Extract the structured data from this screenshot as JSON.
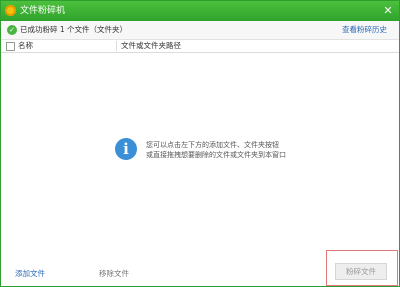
{
  "window": {
    "title": "文件粉碎机",
    "close_glyph": "✕"
  },
  "status": {
    "message": "已成功粉碎 1 个文件（文件夹）",
    "history_link": "查看粉碎历史"
  },
  "table": {
    "columns": [
      "名称",
      "文件或文件夹路径"
    ]
  },
  "hint": {
    "line1": "您可以点击左下方的添加文件、文件夹按钮",
    "line2": "或直接拖拽想要删除的文件或文件夹到本窗口",
    "icon_glyph": "i"
  },
  "footer": {
    "add_file": "添加文件",
    "remove_file": "移除文件",
    "shred": "粉碎文件"
  },
  "colors": {
    "title_green": "#2fa22c",
    "link_blue": "#2a6ab8",
    "info_blue": "#3b8fd6",
    "highlight_red": "#e07a7a"
  },
  "icons": {
    "app": "shredder-app-icon",
    "status": "check-circle-icon",
    "close": "close-icon",
    "hint": "info-icon"
  }
}
